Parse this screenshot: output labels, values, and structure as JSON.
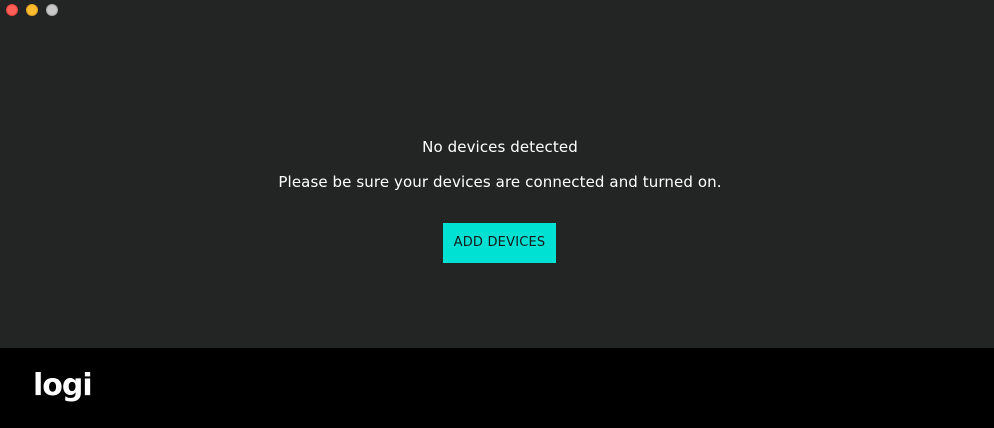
{
  "window": {
    "controls": [
      "close",
      "minimize",
      "zoom"
    ]
  },
  "main": {
    "headline": "No devices detected",
    "message": "Please be sure your devices are connected and turned on.",
    "add_button_label": "ADD DEVICES"
  },
  "footer": {
    "logo_text": "logi"
  },
  "colors": {
    "background": "#232424",
    "footer_background": "#000000",
    "accent": "#00e1d3",
    "text": "#ffffff"
  }
}
